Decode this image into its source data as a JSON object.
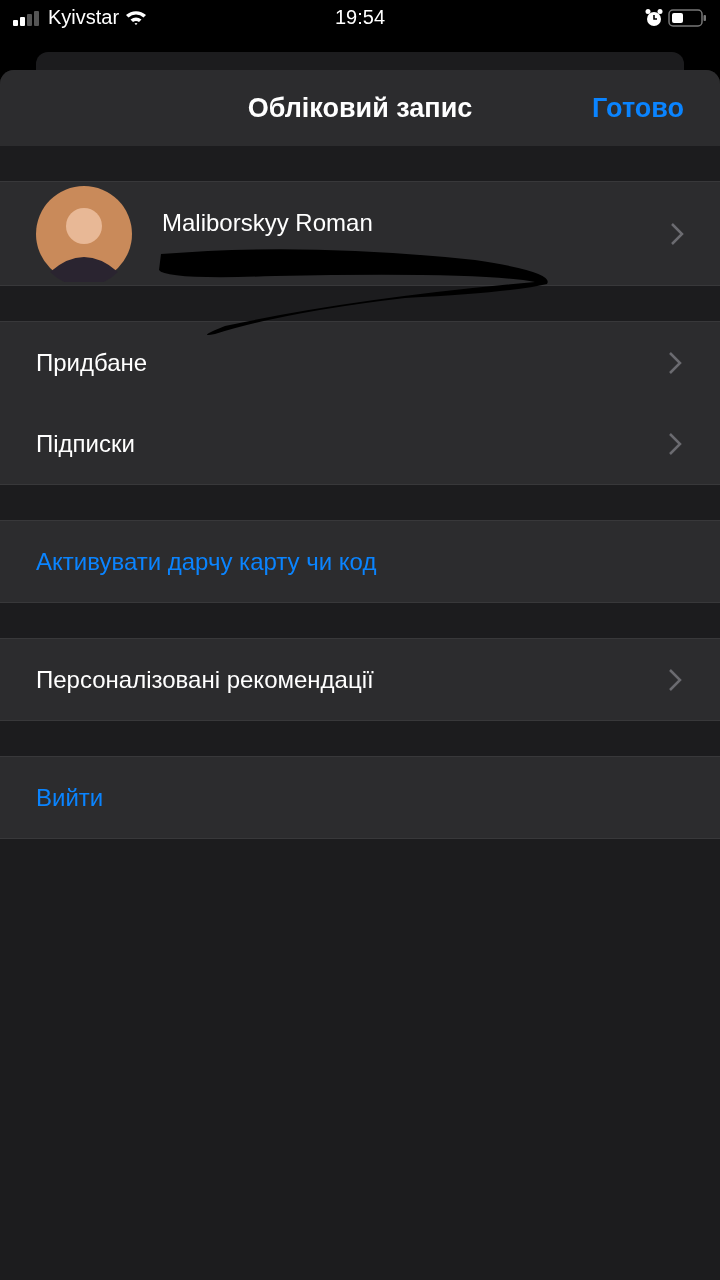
{
  "status_bar": {
    "carrier": "Kyivstar",
    "time": "19:54"
  },
  "header": {
    "title": "Обліковий запис",
    "done": "Готово"
  },
  "profile": {
    "name": "Maliborskyy Roman"
  },
  "sections": [
    {
      "rows": [
        {
          "label": "Придбане",
          "kind": "link"
        },
        {
          "label": "Підписки",
          "kind": "link"
        }
      ]
    },
    {
      "rows": [
        {
          "label": "Активувати дарчу карту чи код",
          "kind": "action"
        }
      ]
    },
    {
      "rows": [
        {
          "label": "Персоналізовані рекомендації",
          "kind": "link"
        }
      ]
    },
    {
      "rows": [
        {
          "label": "Вийти",
          "kind": "action"
        }
      ]
    }
  ]
}
